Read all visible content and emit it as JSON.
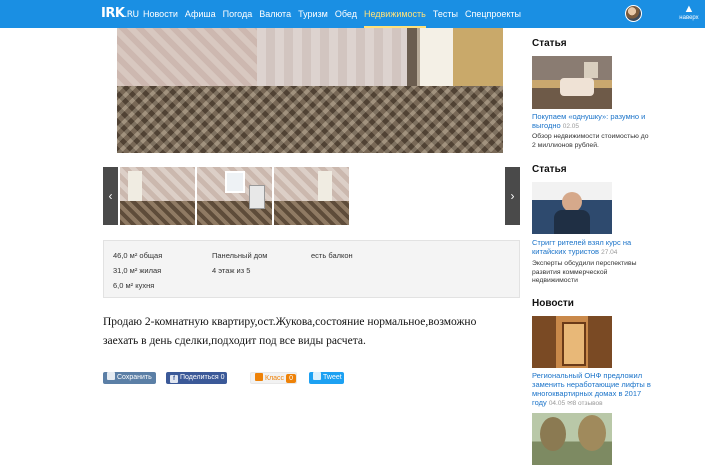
{
  "header": {
    "logo_text": "IRK",
    "logo_suffix": ".RU",
    "nav": [
      "Новости",
      "Афиша",
      "Погода",
      "Валюта",
      "Туризм",
      "Обед",
      "Недвижимость",
      "Тесты",
      "Спецпроекты"
    ],
    "active_nav": "Недвижимость",
    "back_to_top": "наверх"
  },
  "colors": {
    "header_bg": "#1a8fe3",
    "active_nav": "#ffe27a",
    "link": "#1a73c9"
  },
  "gallery": {
    "prev_icon": "‹",
    "next_icon": "›"
  },
  "details": {
    "area_total": "46,0 м² общая",
    "area_living": "31,0 м² жилая",
    "area_kitchen": "6,0 м² кухня",
    "building_type": "Панельный дом",
    "floor": "4 этаж из 5",
    "balcony": "есть балкон"
  },
  "description": "Продаю 2-комнатную квартиру,ост.Жукова,состояние нормальное,возможно заехать в день сделки,подходит под все виды расчета.",
  "share": {
    "vk_label": "Сохранить",
    "fb_label": "Поделиться",
    "fb_count": "0",
    "ok_label": "Класс",
    "ok_count": "0",
    "tw_label": "Tweet"
  },
  "sidebar": {
    "blocks": [
      {
        "heading": "Статья",
        "title": "Покупаем «однушку»: разумно и выгодно",
        "date": "02.05",
        "subtitle": "Обзор недвижимости стоимостью до 2 миллионов рублей."
      },
      {
        "heading": "Статья",
        "title": "Стригт рителей взял курс на китайских туристов",
        "date": "27.04",
        "subtitle": "Эксперты обсудили перспективы развития коммерческой недвижимости"
      },
      {
        "heading": "Новости",
        "title": "Региональный ОНФ предложил заменить неработающие лифты в многоквартирных домах в 2017 году",
        "date": "04.05",
        "comments": "8 отзывов"
      }
    ]
  }
}
